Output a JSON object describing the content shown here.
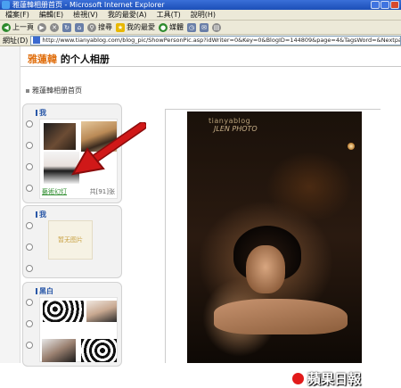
{
  "window": {
    "title": "雅蓮韓相册首页 - Microsoft Internet Explorer"
  },
  "menu": [
    "檔案(F)",
    "編輯(E)",
    "檢視(V)",
    "我的最愛(A)",
    "工具(T)",
    "說明(H)"
  ],
  "toolbar": {
    "back": "上一頁",
    "search": "搜尋",
    "favorites": "我的最愛",
    "media": "媒體"
  },
  "address": {
    "label": "網址(D)",
    "url": "http://www.tianyablog.com/blog_pic/ShowPersonPic.asp?idWriter=0&Key=0&BlogID=144809&page=4&TagsWord=&Nextpage=1795780&CurScreenID="
  },
  "page": {
    "owner": "雅蓮韓",
    "title_suffix": " 的个人相册",
    "breadcrumb": "雅蓮韓相册首页"
  },
  "albums": [
    {
      "title": "我",
      "caption": "藝術幻灯",
      "count": "共[91]张"
    },
    {
      "title": "我",
      "empty_label": "暂无图片"
    },
    {
      "title": "黑白"
    }
  ],
  "photo": {
    "watermark1": "tianyablog",
    "watermark2": "JLEN PHOTO"
  },
  "brand": {
    "name": "蘋果日報"
  },
  "colors": {
    "owner_name": "#e07010",
    "album_header": "#2a58a8",
    "arrow": "#d01818"
  }
}
